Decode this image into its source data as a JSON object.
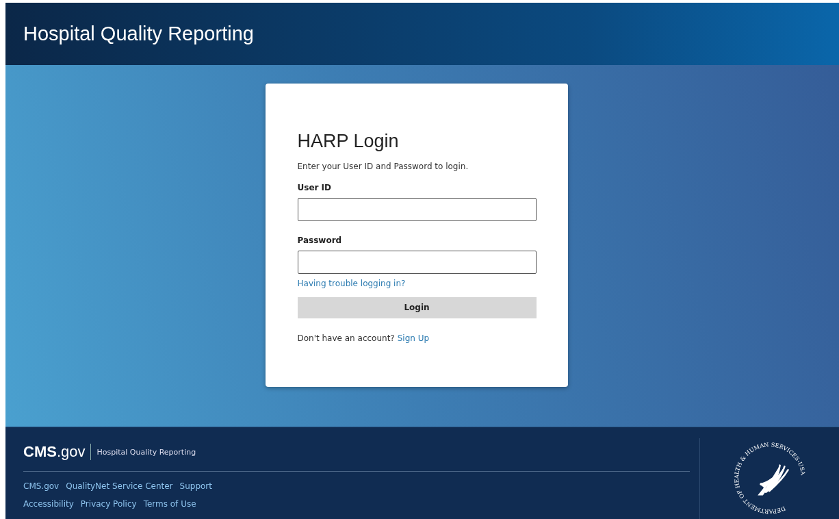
{
  "header": {
    "title": "Hospital Quality Reporting"
  },
  "login": {
    "title": "HARP Login",
    "intro": "Enter your User ID and Password to login.",
    "fields": [
      {
        "label": "User ID"
      },
      {
        "label": "Password"
      }
    ],
    "help_link": "Having trouble logging in?",
    "button": "Login",
    "signup_prompt": "Don't have an account?",
    "signup_link": "Sign Up"
  },
  "footer": {
    "logo": "**CMS**.gov",
    "site_name": "Hospital Quality Reporting",
    "link_rows": [
      [
        "CMS.gov",
        "QualityNet Service Center",
        "Support"
      ],
      [
        "Accessibility",
        "Privacy Policy",
        "Terms of Use"
      ]
    ],
    "seal_text": "DEPARTMENT OF HEALTH & HUMAN SERVICES-USA"
  }
}
